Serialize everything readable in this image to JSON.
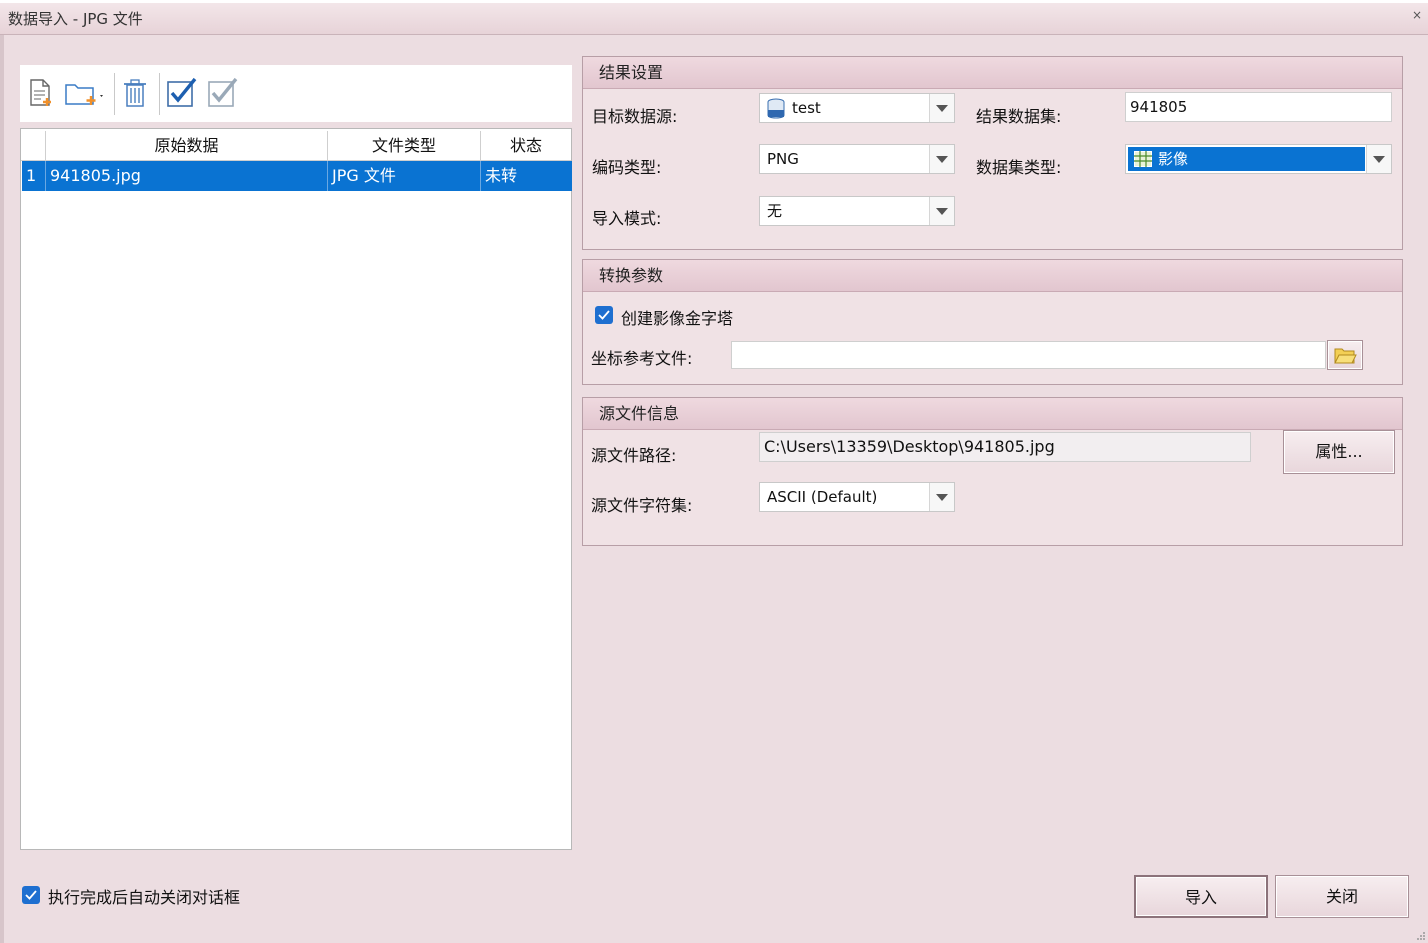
{
  "window": {
    "title": "数据导入 - JPG 文件",
    "close_glyph": "×"
  },
  "toolbar": {
    "add_file_icon": "add-file-icon",
    "add_folder_icon": "add-folder-icon",
    "delete_icon": "delete-icon",
    "select_all_icon": "check-all-icon",
    "invert_select_icon": "check-invert-icon"
  },
  "grid": {
    "columns": [
      "原始数据",
      "文件类型",
      "状态"
    ],
    "rows": [
      {
        "index": "1",
        "source": "941805.jpg",
        "type": "JPG 文件",
        "status": "未转"
      }
    ]
  },
  "result_settings": {
    "title": "结果设置",
    "target_datasource_label": "目标数据源:",
    "target_datasource_value": "test",
    "result_dataset_label": "结果数据集:",
    "result_dataset_value": "941805",
    "encoding_label": "编码类型:",
    "encoding_value": "PNG",
    "dataset_type_label": "数据集类型:",
    "dataset_type_value": "影像",
    "import_mode_label": "导入模式:",
    "import_mode_value": "无"
  },
  "conversion": {
    "title": "转换参数",
    "pyramid_label": "创建影像金字塔",
    "pyramid_checked": true,
    "coord_file_label": "坐标参考文件:",
    "coord_file_value": ""
  },
  "source_info": {
    "title": "源文件信息",
    "path_label": "源文件路径:",
    "path_value": "C:\\Users\\13359\\Desktop\\941805.jpg",
    "properties_button": "属性...",
    "charset_label": "源文件字符集:",
    "charset_value": "ASCII (Default)"
  },
  "footer": {
    "auto_close_label": "执行完成后自动关闭对话框",
    "auto_close_checked": true,
    "import_button": "导入",
    "close_button": "关闭"
  },
  "colors": {
    "selection": "#0a73d2",
    "accent": "#1e6fd0",
    "background": "#ecdde1"
  }
}
